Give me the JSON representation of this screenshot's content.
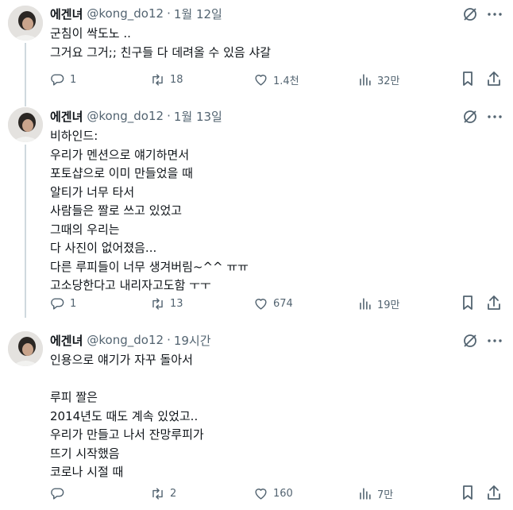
{
  "tweets": [
    {
      "name": "에겐녀",
      "handle": "@kong_do12",
      "dot": "·",
      "time": "1월 12일",
      "lines": [
        "군침이 싹도노 ..",
        "그거요 그거;; 친구들 다 데려올 수 있음 샤갈"
      ],
      "replies": "1",
      "retweets": "18",
      "likes": "1.4천",
      "views": "32만"
    },
    {
      "name": "에겐녀",
      "handle": "@kong_do12",
      "dot": "·",
      "time": "1월 13일",
      "lines": [
        "비하인드:",
        "우리가 멘션으로 얘기하면서",
        "포토샵으로 이미 만들었을 때",
        "알티가 너무 타서",
        "사람들은 짤로 쓰고 있었고",
        "그때의 우리는",
        "다 사진이 없어졌음...",
        "다른 루피들이 너무 생겨버림~^^ ㅠㅠ",
        "고소당한다고 내리자고도함 ㅜㅜ"
      ],
      "replies": "1",
      "retweets": "13",
      "likes": "674",
      "views": "19만"
    },
    {
      "name": "에겐녀",
      "handle": "@kong_do12",
      "dot": "·",
      "time": "19시간",
      "lines": [
        "인용으로 얘기가 자꾸 돌아서",
        "",
        "루피 짤은",
        "2014년도 때도 계속 있었고..",
        "우리가 만들고 나서 잔망루피가",
        "뜨기 시작했음",
        "코로나 시절 때"
      ],
      "replies": "",
      "retweets": "2",
      "likes": "160",
      "views": "7만"
    }
  ],
  "icons": {
    "reply": "reply-icon",
    "retweet": "retweet-icon",
    "like": "heart-icon",
    "views": "views-chart-icon",
    "bookmark": "bookmark-icon",
    "share": "share-icon",
    "grok": "grok-icon",
    "more": "more-icon"
  },
  "colors": {
    "text": "#0f1419",
    "secondary": "#536471",
    "thread_line": "#cfd9de"
  }
}
